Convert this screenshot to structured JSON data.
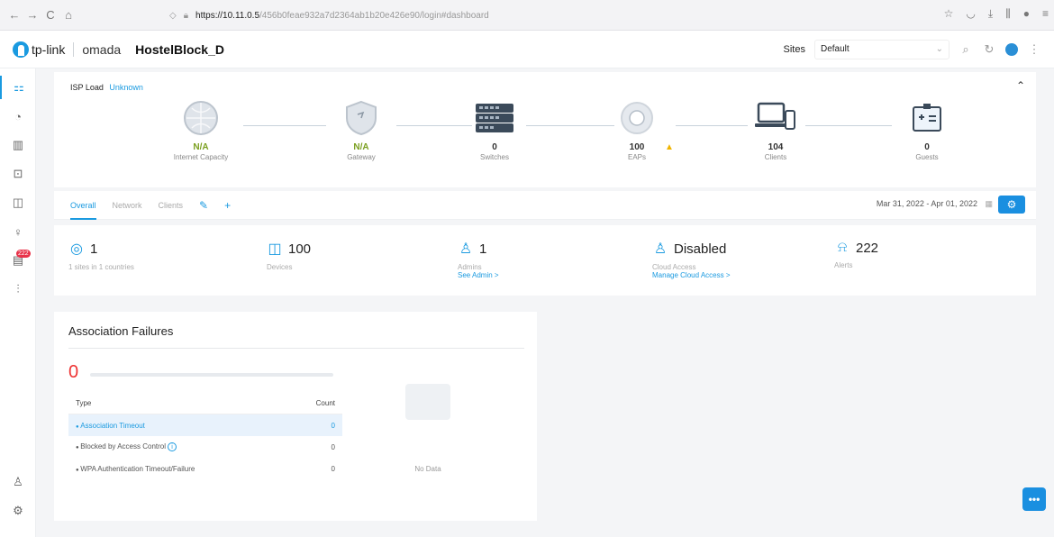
{
  "browser": {
    "url_host": "https://10.11.0.5",
    "url_path": "/456b0feae932a7d2364ab1b20e426e90/login#dashboard",
    "back": "←",
    "forward": "→",
    "reload": "C",
    "home": "⌂"
  },
  "header": {
    "brand_tplink": "tp-link",
    "brand_omada": "omada",
    "site_name": "HostelBlock_D",
    "sites_label": "Sites",
    "site_selected": "Default"
  },
  "sidebar": {
    "alerts_badge": "222"
  },
  "topology": {
    "isp_label": "ISP Load",
    "isp_value": "Unknown",
    "nodes": [
      {
        "value": "N/A",
        "label": "Internet Capacity"
      },
      {
        "value": "N/A",
        "label": "Gateway"
      },
      {
        "value": "0",
        "label": "Switches"
      },
      {
        "value": "100",
        "label": "EAPs"
      },
      {
        "value": "104",
        "label": "Clients"
      },
      {
        "value": "0",
        "label": "Guests"
      }
    ]
  },
  "tabs": [
    "Overall",
    "Network",
    "Clients"
  ],
  "date_range": "Mar 31, 2022 - Apr 01, 2022",
  "summary": [
    {
      "value": "1",
      "sub": "1 sites in 1 countries",
      "link": ""
    },
    {
      "value": "100",
      "sub": "Devices",
      "link": ""
    },
    {
      "value": "1",
      "sub": "Admins",
      "link": "See Admin >"
    },
    {
      "value": "Disabled",
      "sub": "Cloud Access",
      "link": "Manage Cloud Access >"
    },
    {
      "value": "222",
      "sub": "Alerts",
      "link": ""
    }
  ],
  "assoc": {
    "title": "Association Failures",
    "total": "0",
    "col_type": "Type",
    "col_count": "Count",
    "rows": [
      {
        "name": "Association Timeout",
        "count": "0"
      },
      {
        "name": "Blocked by Access Control",
        "count": "0"
      },
      {
        "name": "WPA Authentication Timeout/Failure",
        "count": "0"
      }
    ],
    "no_data": "No Data"
  },
  "colors": {
    "accent": "#1a9ae0",
    "alert": "#e8334a"
  }
}
